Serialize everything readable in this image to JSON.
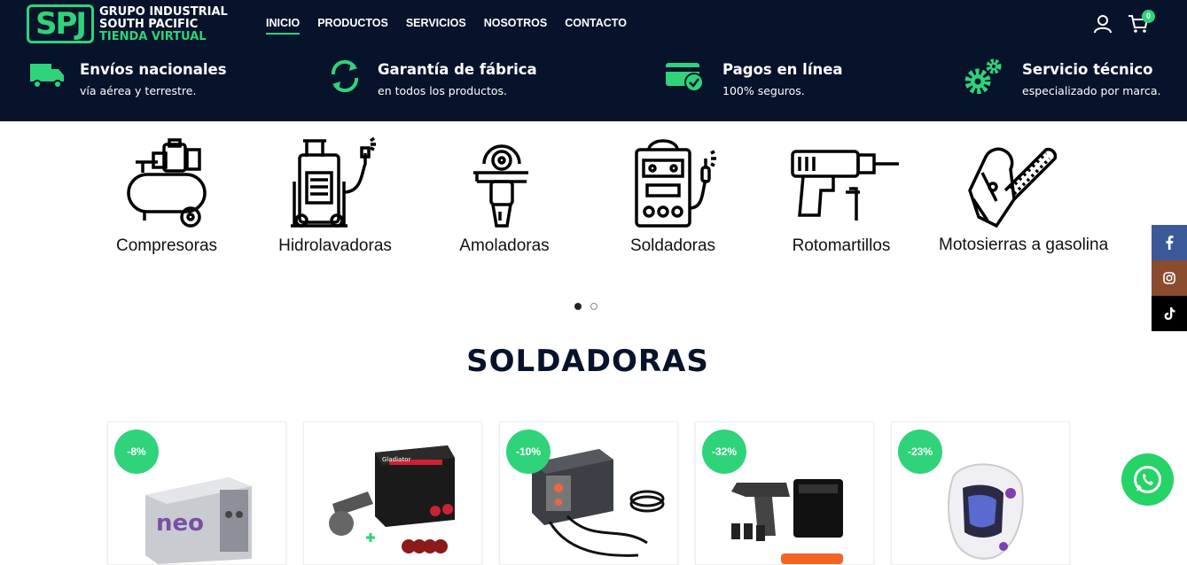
{
  "brand": {
    "mark": "SPJ",
    "line1": "GRUPO INDUSTRIAL",
    "line2": "SOUTH PACIFIC",
    "line3": "TIENDA VIRTUAL"
  },
  "nav": [
    {
      "label": "INICIO",
      "active": true
    },
    {
      "label": "PRODUCTOS",
      "active": false
    },
    {
      "label": "SERVICIOS",
      "active": false
    },
    {
      "label": "NOSOTROS",
      "active": false
    },
    {
      "label": "CONTACTO",
      "active": false
    }
  ],
  "cart": {
    "count": "0"
  },
  "features": [
    {
      "title": "Envíos nacionales",
      "subtitle": "vía aérea y terrestre.",
      "icon": "truck-icon"
    },
    {
      "title": "Garantía de fábrica",
      "subtitle": "en todos los productos.",
      "icon": "refresh-icon"
    },
    {
      "title": "Pagos en línea",
      "subtitle": "100% seguros.",
      "icon": "card-check-icon"
    },
    {
      "title": "Servicio técnico",
      "subtitle": "especializado por marca.",
      "icon": "gears-icon"
    }
  ],
  "categories": [
    {
      "label": "Compresoras",
      "icon": "compressor-icon"
    },
    {
      "label": "Hidrolavadoras",
      "icon": "pressure-washer-icon"
    },
    {
      "label": "Amoladoras",
      "icon": "angle-grinder-icon"
    },
    {
      "label": "Soldadoras",
      "icon": "welder-icon"
    },
    {
      "label": "Rotomartillos",
      "icon": "rotary-hammer-icon"
    },
    {
      "label": "Motosierras a gasolina",
      "icon": "chainsaw-icon"
    }
  ],
  "carousel": {
    "pages": 2,
    "active": 1
  },
  "section": {
    "title": "SOLDADORAS"
  },
  "products": [
    {
      "discount": "-8%",
      "image_label": "neo"
    },
    {
      "discount": "",
      "image_label": "Gladiator"
    },
    {
      "discount": "-10%",
      "image_label": ""
    },
    {
      "discount": "-32%",
      "image_label": ""
    },
    {
      "discount": "-23%",
      "image_label": ""
    }
  ],
  "colors": {
    "header_bg": "#07132b",
    "accent": "#2fd37a",
    "facebook": "#3b5998",
    "instagram": "#8a4b2e",
    "tiktok": "#000000",
    "whatsapp": "#25d366"
  }
}
